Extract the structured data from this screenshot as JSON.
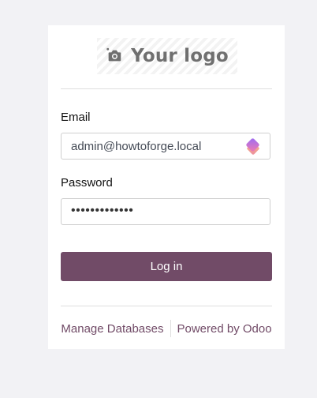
{
  "logo": {
    "text": "Your logo",
    "icon": "camera-plus-icon"
  },
  "form": {
    "email_label": "Email",
    "email_value": "admin@howtoforge.local",
    "password_label": "Password",
    "password_masked": "•••••••••••••",
    "password_manager_icon": "password-manager-icon",
    "login_button": "Log in"
  },
  "footer": {
    "manage_databases": "Manage Databases",
    "powered_by": "Powered by Odoo"
  },
  "colors": {
    "brand": "#714b67",
    "background": "#f2f2f5",
    "card": "#ffffff"
  }
}
